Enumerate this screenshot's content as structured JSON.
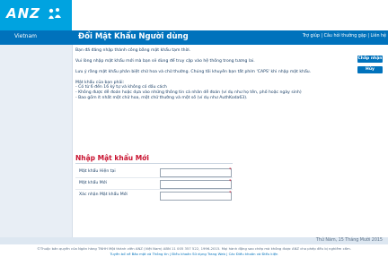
{
  "brand": {
    "logo_text": "ANZ",
    "accent": "#00a3e0",
    "nav_color": "#0072bc"
  },
  "nav": {
    "region": "Vietnam",
    "title": "Đổi Mật Khẩu Người dùng",
    "links": "Trợ giúp | Câu hỏi thường gặp | Liên hệ"
  },
  "content": {
    "messages": [
      "Bạn đã đăng nhập thành công bằng mật khẩu tạm thời.",
      "Vui lòng nhập mật khẩu mới mà bạn sẽ dùng để truy cập vào hệ thống trong tương lai.",
      "Lưu ý rằng mật khẩu phân biệt chữ hoa và chữ thường. Chúng tôi khuyên bạn tắt phím 'CAPS' khi nhập mật khẩu."
    ],
    "rules_title": "Mật khẩu của bạn phải:",
    "rules": [
      "- Có từ 6 đến 16 ký tự và không có dấu cách",
      "- Không được dễ đoán hoặc dựa vào những thông tin cá nhân dễ đoán (ví dụ như họ tên, phố hoặc ngày sinh)",
      "- Bao gồm ít nhất một chữ hoa, một chữ thường và một số (ví dụ như AuthKoda63)."
    ]
  },
  "buttons": {
    "continue": "Chấp nhận",
    "cancel": "Hủy"
  },
  "form": {
    "title": "Nhập Mật khẩu Mới",
    "fields": [
      {
        "label": "Mật khẩu Hiện tại",
        "value": "",
        "required": "*"
      },
      {
        "label": "Mật khẩu Mới",
        "value": "",
        "required": "*"
      },
      {
        "label": "Xác nhận Mật khẩu Mới",
        "value": "",
        "required": "*"
      }
    ]
  },
  "footer": {
    "date": "Thứ Năm, 15 Tháng Mười 2015",
    "copyright": "©Thuộc bản quyền của Ngân hàng TNHH Một thành viên ANZ (Việt Nam) ABN 11 005 357 522, 1996-2015. Mọi hành động sao chép mà không được ANZ cho phép đều bị nghiêm cấm.",
    "links": "Tuyên bố về Bảo mật và Thông tin | Điều khoản Sử dụng Trang Web | Các Điều khoản và Điều kiện"
  }
}
